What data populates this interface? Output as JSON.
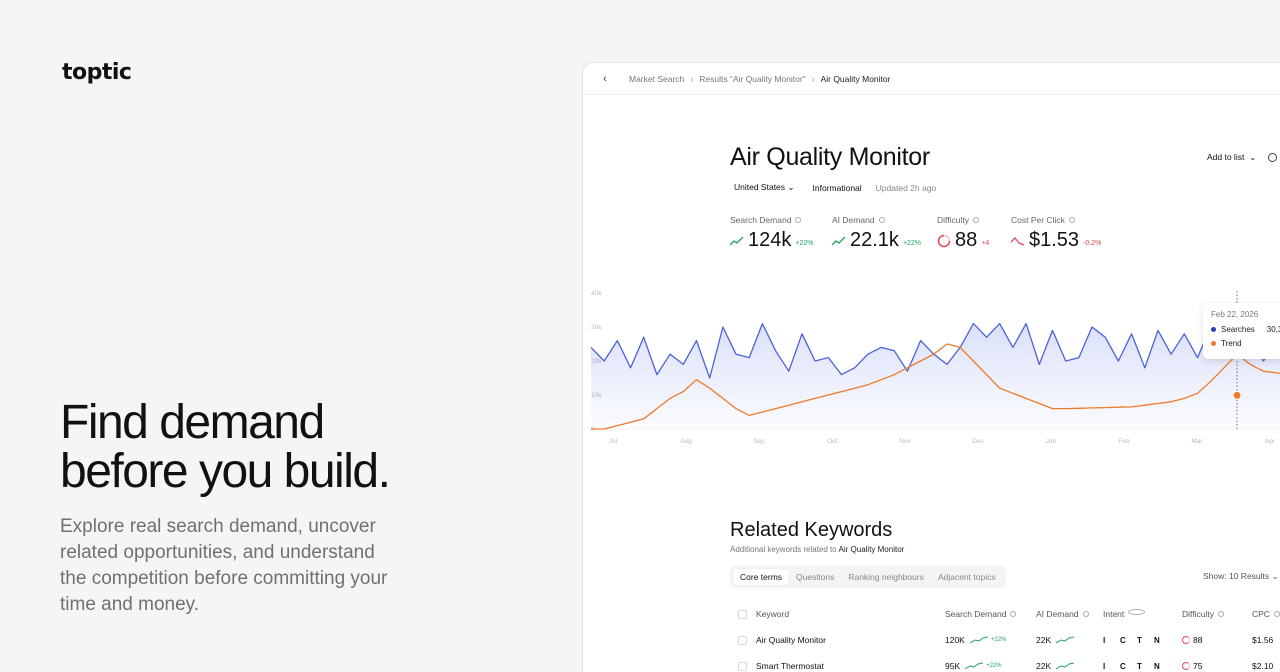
{
  "brand": {
    "logo": "toptic"
  },
  "hero": {
    "headline_line1": "Find demand",
    "headline_line2": "before you build.",
    "body": "Explore real search demand, uncover related opportunities, and understand the competition before committing your time and money."
  },
  "breadcrumb": {
    "items": [
      "Market Search",
      "Results “Air Quality Monitor”",
      "Air Quality Monitor"
    ]
  },
  "page": {
    "title": "Air Quality Monitor",
    "country": "United States",
    "intent": "Informational",
    "updated": "Updated 2h ago",
    "add_to_list": "Add to list"
  },
  "stats": [
    {
      "label": "Search Demand",
      "value": "124k",
      "change": "+22%",
      "trend": "up"
    },
    {
      "label": "AI Demand",
      "value": "22.1k",
      "change": "+22%",
      "trend": "up"
    },
    {
      "label": "Difficulty",
      "value": "88",
      "change": "+4",
      "trend": "down"
    },
    {
      "label": "Cost Per Click",
      "value": "$1.53",
      "change": "-0.2%",
      "trend": "down"
    }
  ],
  "chart_data": {
    "type": "line",
    "y_ticks": [
      "40k",
      "30k",
      "20k",
      "10k",
      "0"
    ],
    "x_ticks": [
      "Jul",
      "Aug",
      "Sep",
      "Oct",
      "Nov",
      "Dec",
      "Jan",
      "Feb",
      "Mar",
      "Apr"
    ],
    "ylim": [
      0,
      40000
    ],
    "series": [
      {
        "name": "Searches",
        "color": "#4a63d6",
        "values": [
          24000,
          20000,
          26000,
          18000,
          27000,
          16000,
          22000,
          19000,
          26000,
          15000,
          30000,
          22000,
          21000,
          31000,
          23000,
          17000,
          28000,
          20000,
          21000,
          16000,
          18000,
          22000,
          24000,
          23000,
          17000,
          26000,
          22000,
          19000,
          24000,
          31000,
          27000,
          31000,
          24000,
          31000,
          19000,
          29000,
          20000,
          21000,
          30000,
          27000,
          20000,
          28000,
          18000,
          29000,
          22000,
          28000,
          21000,
          30000,
          21000,
          30300,
          27000,
          20000,
          25000,
          24000,
          18000
        ]
      },
      {
        "name": "Trend",
        "color": "#ef7a2a",
        "values": [
          0,
          0,
          1000,
          2000,
          3000,
          6000,
          9000,
          11000,
          14500,
          12000,
          9000,
          6000,
          4000,
          5000,
          6000,
          7000,
          8000,
          9000,
          10000,
          11000,
          12000,
          13000,
          14500,
          16000,
          18000,
          20000,
          22000,
          25000,
          24000,
          20000,
          16000,
          12000,
          10500,
          9000,
          7500,
          6000,
          6000,
          6100,
          6200,
          6300,
          6400,
          6500,
          7000,
          7500,
          8000,
          9000,
          10500,
          14000,
          18000,
          22000,
          19000,
          17000,
          16500,
          16000,
          15500
        ]
      }
    ],
    "tooltip": {
      "date": "Feb 22, 2026",
      "searches_label": "Searches",
      "searches_value": "30,3",
      "trend_label": "Trend"
    }
  },
  "related": {
    "title": "Related Keywords",
    "subtitle_prefix": "Additional keywords related to",
    "subtitle_term": "Air Quality Monitor",
    "tabs": [
      "Core terms",
      "Questions",
      "Ranking neighbours",
      "Adjacent topics"
    ],
    "show": "Show: 10 Results",
    "columns": [
      "Keyword",
      "Search Demand",
      "AI Demand",
      "Intent",
      "Difficulty",
      "CPC"
    ],
    "rows": [
      {
        "keyword": "Air Quality Monitor",
        "search": "120K",
        "search_change": "+22%",
        "ai": "22K",
        "intent": [
          "I",
          "C",
          "T",
          "N"
        ],
        "difficulty": "88",
        "cpc": "$1.56"
      },
      {
        "keyword": "Smart Thermostat",
        "search": "95K",
        "search_change": "+22%",
        "ai": "22K",
        "intent": [
          "I",
          "C",
          "T",
          "N"
        ],
        "difficulty": "75",
        "cpc": "$2.10"
      }
    ]
  }
}
